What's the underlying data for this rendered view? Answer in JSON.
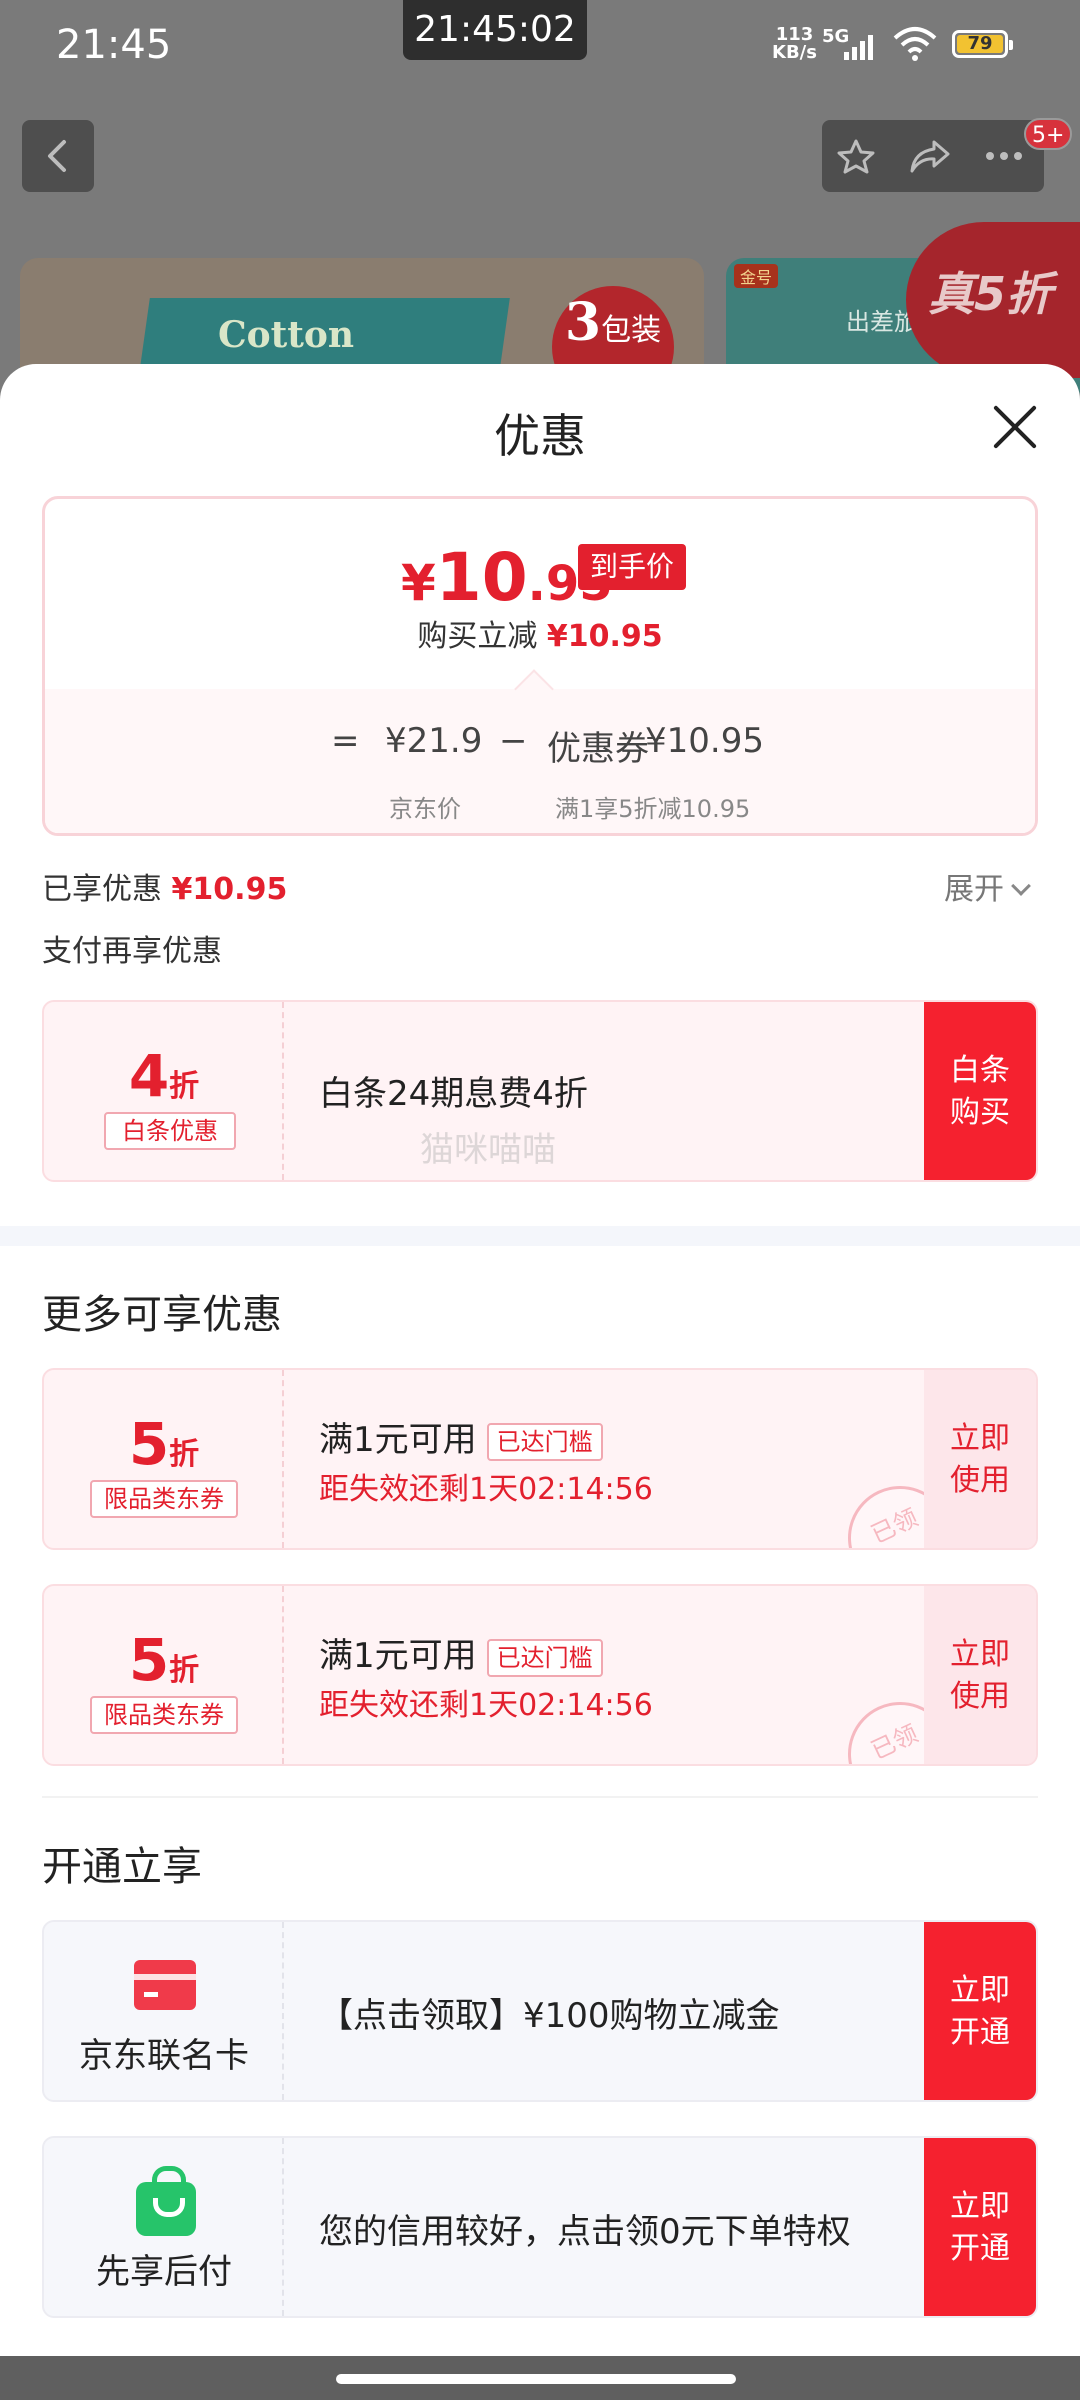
{
  "statusbar": {
    "time": "21:45",
    "center_time": "21:45:02",
    "net_speed_value": "113",
    "net_speed_unit": "KB/s",
    "network": "5G",
    "battery": "79"
  },
  "nav": {
    "notification_badge": "5+"
  },
  "background_products": {
    "tissue_brand": "Cotton",
    "pack_label_num": "3",
    "pack_label_text": "包装",
    "gold_tag": "金号",
    "second_title": "出差旅",
    "promo_badge": "真5折"
  },
  "sheet": {
    "title": "优惠"
  },
  "summary": {
    "final_price_yen": "¥",
    "final_price_int": "10",
    "final_price_dec": ".95",
    "final_price_tag": "到手价",
    "instant_cut_label": "购买立减",
    "instant_cut_value": "¥10.95",
    "equals": "=",
    "jd_price": "¥21.9",
    "minus": "−",
    "coupon_label": "优惠券",
    "coupon_value": "¥10.95",
    "jd_price_caption": "京东价",
    "coupon_caption": "满1享5折减10.95"
  },
  "enjoyed": {
    "label": "已享优惠",
    "value": "¥10.95",
    "expand": "展开"
  },
  "pay_section": {
    "title": "支付再享优惠",
    "baitiao": {
      "discount_num": "4",
      "discount_unit": "折",
      "kind": "白条优惠",
      "desc": "白条24期息费4折",
      "action_line1": "白条",
      "action_line2": "购买"
    }
  },
  "watermark": "猫咪喵喵",
  "more_section": {
    "title": "更多可享优惠",
    "coupons": [
      {
        "discount_num": "5",
        "discount_unit": "折",
        "kind": "限品类东券",
        "condition": "满1元可用",
        "threshold": "已达门槛",
        "countdown": "距失效还剩1天02:14:56",
        "action_line1": "立即",
        "action_line2": "使用",
        "stamp": "已领"
      },
      {
        "discount_num": "5",
        "discount_unit": "折",
        "kind": "限品类东券",
        "condition": "满1元可用",
        "threshold": "已达门槛",
        "countdown": "距失效还剩1天02:14:56",
        "action_line1": "立即",
        "action_line2": "使用",
        "stamp": "已领"
      }
    ]
  },
  "open_section": {
    "title": "开通立享",
    "items": [
      {
        "name": "京东联名卡",
        "desc": "【点击领取】¥100购物立减金",
        "action_line1": "立即",
        "action_line2": "开通"
      },
      {
        "name": "先享后付",
        "desc": "您的信用较好，点击领0元下单特权",
        "action_line1": "立即",
        "action_line2": "开通"
      }
    ]
  },
  "colors": {
    "accent_red": "#e3202e",
    "button_red": "#f5212f",
    "green_icon": "#26c46a"
  }
}
